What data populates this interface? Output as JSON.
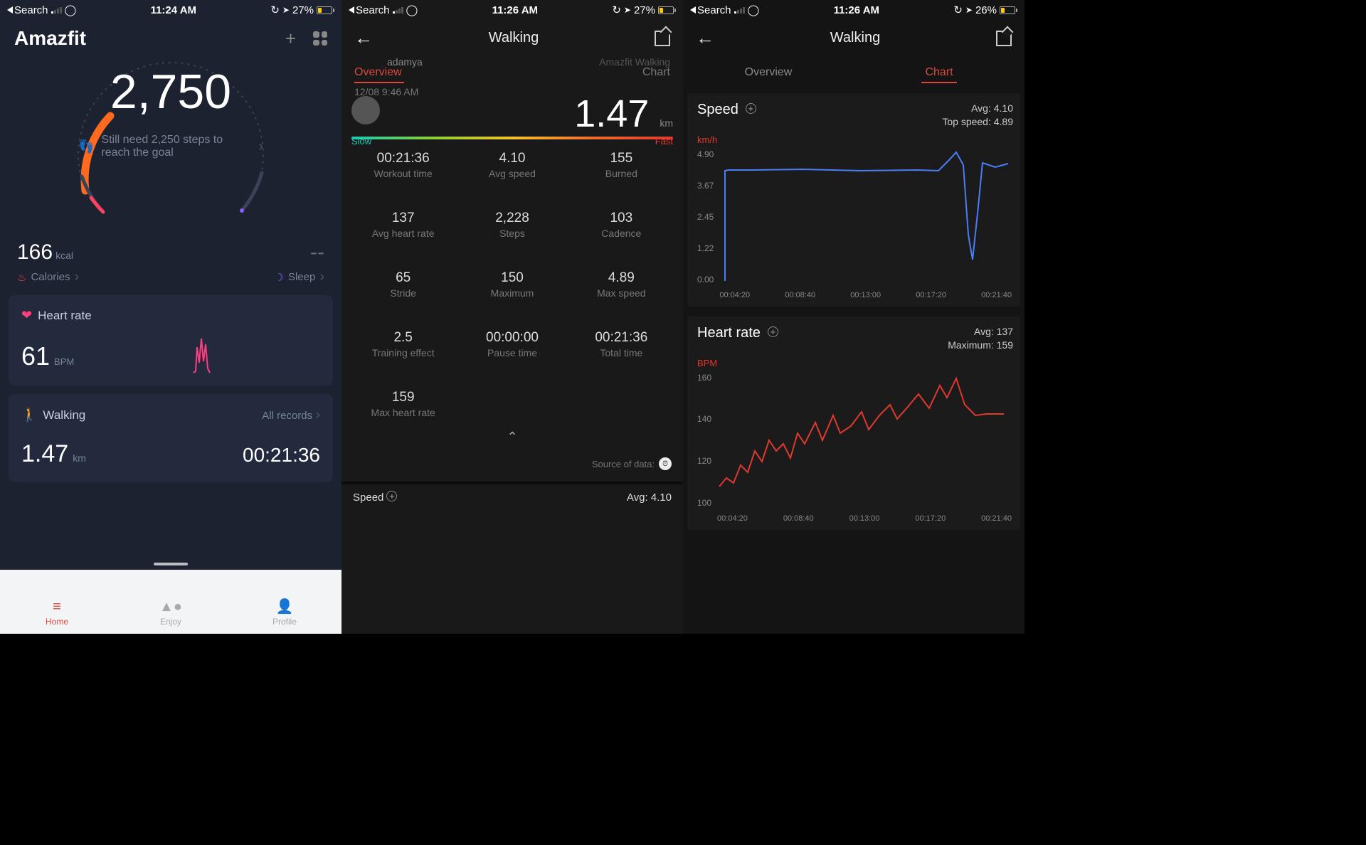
{
  "status": {
    "back_label": "Search",
    "time_s1": "11:24 AM",
    "time_s2": "11:26 AM",
    "time_s3": "11:26 AM",
    "batt_s1": "27%",
    "batt_s2": "27%",
    "batt_s3": "26%"
  },
  "s1": {
    "brand": "Amazfit",
    "steps": "2,750",
    "goal_msg": "Still need 2,250 steps to reach the goal",
    "kcal_val": "166",
    "kcal_unit": "kcal",
    "kcal_label": "Calories",
    "sleep_val": "--",
    "sleep_label": "Sleep",
    "hr_title": "Heart rate",
    "hr_val": "61",
    "hr_unit": "BPM",
    "walk_title": "Walking",
    "all_records": "All records",
    "walk_dist": "1.47",
    "walk_dist_unit": "km",
    "walk_time": "00:21:36",
    "nav_home": "Home",
    "nav_enjoy": "Enjoy",
    "nav_profile": "Profile"
  },
  "s2": {
    "title": "Walking",
    "user": "adamya",
    "tab_overview": "Overview",
    "tab_chart": "Chart",
    "datetime": "12/08 9:46 AM",
    "activity_type": "Amazfit Walking",
    "dist": "1.47",
    "dist_unit": "km",
    "slow": "Slow",
    "fast": "Fast",
    "stats": [
      {
        "v": "00:21:36",
        "l": "Workout time"
      },
      {
        "v": "4.10",
        "l": "Avg speed"
      },
      {
        "v": "155",
        "l": "Burned"
      },
      {
        "v": "137",
        "l": "Avg heart rate"
      },
      {
        "v": "2,228",
        "l": "Steps"
      },
      {
        "v": "103",
        "l": "Cadence"
      },
      {
        "v": "65",
        "l": "Stride"
      },
      {
        "v": "150",
        "l": "Maximum"
      },
      {
        "v": "4.89",
        "l": "Max speed"
      },
      {
        "v": "2.5",
        "l": "Training effect"
      },
      {
        "v": "00:00:00",
        "l": "Pause time"
      },
      {
        "v": "00:21:36",
        "l": "Total time"
      },
      {
        "v": "159",
        "l": "Max heart rate"
      }
    ],
    "source_label": "Source of data:",
    "speed_footer_label": "Speed",
    "speed_footer_avg": "Avg: 4.10"
  },
  "s3": {
    "title": "Walking",
    "tab_overview": "Overview",
    "tab_chart": "Chart",
    "speed": {
      "title": "Speed",
      "avg": "Avg: 4.10",
      "top": "Top speed: 4.89",
      "unit": "km/h",
      "yticks": [
        "4.90",
        "3.67",
        "2.45",
        "1.22",
        "0.00"
      ],
      "xticks": [
        "00:04:20",
        "00:08:40",
        "00:13:00",
        "00:17:20",
        "00:21:40"
      ]
    },
    "hr": {
      "title": "Heart rate",
      "avg": "Avg: 137",
      "max": "Maximum: 159",
      "unit": "BPM",
      "yticks": [
        "160",
        "140",
        "120",
        "100"
      ],
      "xticks": [
        "00:04:20",
        "00:08:40",
        "00:13:00",
        "00:17:20",
        "00:21:40"
      ]
    }
  },
  "chart_data": [
    {
      "type": "line",
      "title": "Speed",
      "ylabel": "km/h",
      "xlabel": "",
      "ylim": [
        0,
        4.9
      ],
      "x": [
        "00:00:00",
        "00:00:30",
        "00:04:20",
        "00:08:40",
        "00:13:00",
        "00:17:20",
        "00:18:40",
        "00:19:10",
        "00:19:40",
        "00:20:10",
        "00:21:00",
        "00:21:40"
      ],
      "values": [
        0.2,
        4.1,
        4.15,
        4.15,
        4.1,
        4.1,
        4.5,
        4.89,
        2.1,
        1.0,
        4.4,
        4.3
      ],
      "annotations": {
        "Avg": 4.1,
        "Top speed": 4.89
      }
    },
    {
      "type": "line",
      "title": "Heart rate",
      "ylabel": "BPM",
      "xlabel": "",
      "ylim": [
        100,
        160
      ],
      "x": [
        "00:00:00",
        "00:02:10",
        "00:04:20",
        "00:06:30",
        "00:08:40",
        "00:10:50",
        "00:13:00",
        "00:15:10",
        "00:17:20",
        "00:18:40",
        "00:19:30",
        "00:21:40"
      ],
      "values": [
        113,
        120,
        130,
        128,
        140,
        135,
        142,
        147,
        155,
        159,
        145,
        140
      ],
      "annotations": {
        "Avg": 137,
        "Maximum": 159
      }
    }
  ]
}
